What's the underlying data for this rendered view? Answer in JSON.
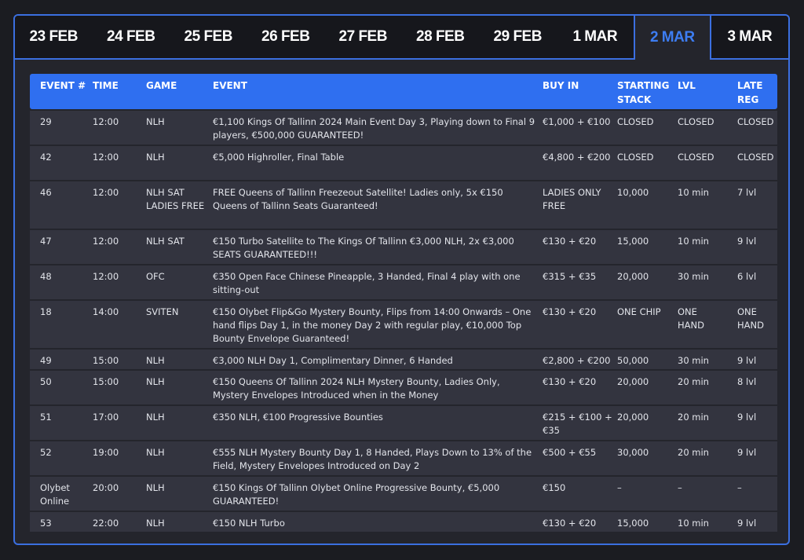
{
  "tabs": [
    {
      "label": "23 FEB",
      "active": false
    },
    {
      "label": "24 FEB",
      "active": false
    },
    {
      "label": "25 FEB",
      "active": false
    },
    {
      "label": "26 FEB",
      "active": false
    },
    {
      "label": "27 FEB",
      "active": false
    },
    {
      "label": "28 FEB",
      "active": false
    },
    {
      "label": "29 FEB",
      "active": false
    },
    {
      "label": "1 MAR",
      "active": false
    },
    {
      "label": "2 MAR",
      "active": true
    },
    {
      "label": "3 MAR",
      "active": false
    }
  ],
  "colors": {
    "accent": "#2f6ff0",
    "active_tab_text": "#3d7df2",
    "row_bg": "#33343f",
    "page_bg": "#1b1c21"
  },
  "table": {
    "headers": {
      "event_num": "EVENT #",
      "time": "TIME",
      "game": "GAME",
      "event": "EVENT",
      "buy_in": "BUY IN",
      "starting_stack": "STARTING STACK",
      "lvl": "LVL",
      "late_reg": "LATE REG"
    },
    "rows": [
      {
        "event_num": "29",
        "time": "12:00",
        "game": "NLH",
        "event": "€1,100 Kings Of Tallinn 2024 Main Event Day 3, Playing down to Final 9 players, €500,000 GUARANTEED!",
        "buy_in": "€1,000 + €100",
        "starting_stack": "CLOSED",
        "lvl": "CLOSED",
        "late_reg": "CLOSED"
      },
      {
        "event_num": "42",
        "time": "12:00",
        "game": "NLH",
        "event": "€5,000 Highroller, Final Table",
        "buy_in": "€4,800 + €200",
        "starting_stack": "CLOSED",
        "lvl": "CLOSED",
        "late_reg": "CLOSED"
      },
      {
        "event_num": "46",
        "time": "12:00",
        "game": "NLH SAT LADIES FREE",
        "event": "FREE Queens of Tallinn Freezeout Satellite! Ladies only, 5x €150 Queens of Tallinn Seats Guaranteed!",
        "buy_in": "LADIES ONLY FREE",
        "starting_stack": "10,000",
        "lvl": "10 min",
        "late_reg": "7 lvl"
      },
      {
        "event_num": "47",
        "time": "12:00",
        "game": "NLH SAT",
        "event": "€150 Turbo Satellite to The Kings Of Tallinn €3,000 NLH, 2x €3,000 SEATS GUARANTEED!!!",
        "buy_in": "€130 + €20",
        "starting_stack": "15,000",
        "lvl": "10 min",
        "late_reg": "9 lvl"
      },
      {
        "event_num": "48",
        "time": "12:00",
        "game": "OFC",
        "event": "€350 Open Face Chinese Pineapple, 3 Handed, Final 4 play with one sitting-out",
        "buy_in": "€315 + €35",
        "starting_stack": "20,000",
        "lvl": "30 min",
        "late_reg": "6 lvl"
      },
      {
        "event_num": "18",
        "time": "14:00",
        "game": "SVITEN",
        "event": "€150 Olybet Flip&Go Mystery Bounty, Flips from 14:00 Onwards – One hand flips Day 1, in the money Day 2 with regular play, €10,000 Top Bounty Envelope Guaranteed!",
        "buy_in": "€130 + €20",
        "starting_stack": "ONE CHIP",
        "lvl": "ONE HAND",
        "late_reg": "ONE HAND"
      },
      {
        "event_num": "49",
        "time": "15:00",
        "game": "NLH",
        "event": "€3,000 NLH Day 1, Complimentary Dinner, 6 Handed",
        "buy_in": "€2,800 + €200",
        "starting_stack": "50,000",
        "lvl": "30 min",
        "late_reg": "9 lvl"
      },
      {
        "event_num": "50",
        "time": "15:00",
        "game": "NLH",
        "event": "€150 Queens Of Tallinn 2024 NLH Mystery Bounty, Ladies Only, Mystery Envelopes Introduced when in the Money",
        "buy_in": "€130 + €20",
        "starting_stack": "20,000",
        "lvl": "20 min",
        "late_reg": "8 lvl"
      },
      {
        "event_num": "51",
        "time": "17:00",
        "game": "NLH",
        "event": "€350 NLH, €100 Progressive Bounties",
        "buy_in": "€215 + €100 + €35",
        "starting_stack": "20,000",
        "lvl": "20 min",
        "late_reg": "9 lvl"
      },
      {
        "event_num": "52",
        "time": "19:00",
        "game": "NLH",
        "event": "€555 NLH Mystery Bounty Day 1, 8 Handed, Plays Down to 13% of the Field, Mystery Envelopes Introduced on Day 2",
        "buy_in": "€500 + €55",
        "starting_stack": "30,000",
        "lvl": "20 min",
        "late_reg": "9 lvl"
      },
      {
        "event_num": "Olybet Online",
        "time": "20:00",
        "game": "NLH",
        "event": "€150 Kings Of Tallinn Olybet Online Progressive Bounty, €5,000 GUARANTEED!",
        "buy_in": "€150",
        "starting_stack": "–",
        "lvl": "–",
        "late_reg": "–"
      },
      {
        "event_num": "53",
        "time": "22:00",
        "game": "NLH",
        "event": "€150 NLH Turbo",
        "buy_in": "€130 + €20",
        "starting_stack": "15,000",
        "lvl": "10 min",
        "late_reg": "9 lvl"
      }
    ]
  }
}
